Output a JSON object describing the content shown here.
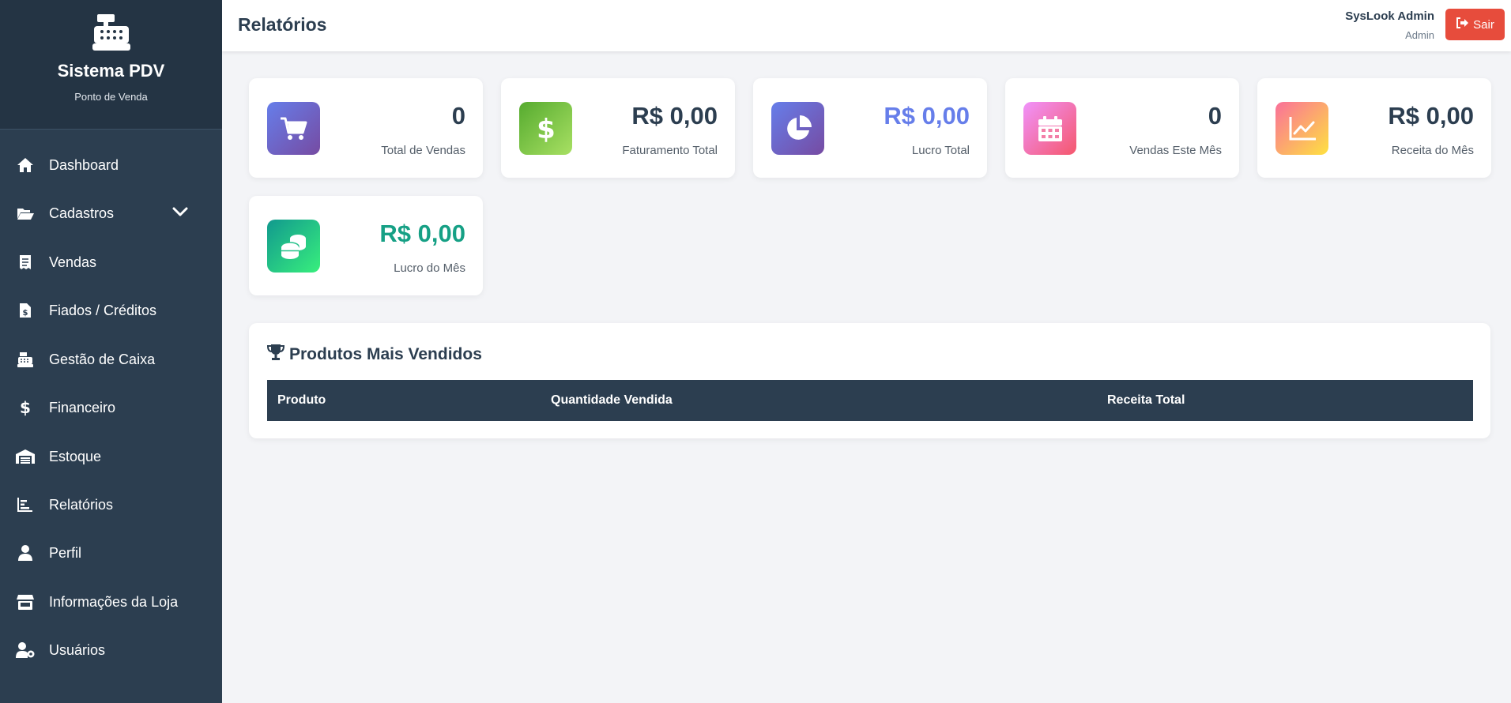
{
  "brand": {
    "title": "Sistema PDV",
    "subtitle": "Ponto de Venda"
  },
  "sidebar": {
    "items": [
      {
        "label": "Dashboard",
        "icon": "home-icon"
      },
      {
        "label": "Cadastros",
        "icon": "folder-open-icon"
      },
      {
        "label": "Vendas",
        "icon": "receipt-icon"
      },
      {
        "label": "Fiados / Créditos",
        "icon": "invoice-dollar-icon"
      },
      {
        "label": "Gestão de Caixa",
        "icon": "cash-register-icon"
      },
      {
        "label": "Financeiro",
        "icon": "dollar-icon"
      },
      {
        "label": "Estoque",
        "icon": "warehouse-icon"
      },
      {
        "label": "Relatórios",
        "icon": "chart-bar-icon"
      },
      {
        "label": "Perfil",
        "icon": "user-icon"
      },
      {
        "label": "Informações da Loja",
        "icon": "store-icon"
      },
      {
        "label": "Usuários",
        "icon": "user-gear-icon"
      }
    ]
  },
  "header": {
    "title": "Relatórios",
    "user_name": "SysLook Admin",
    "user_role": "Admin",
    "logout_label": "Sair"
  },
  "cards": [
    {
      "value": "0",
      "label": "Total de Vendas",
      "icon": "cart-icon",
      "value_color": "#2c3e50"
    },
    {
      "value": "R$ 0,00",
      "label": "Faturamento Total",
      "icon": "dollar-icon",
      "value_color": "#2c3e50"
    },
    {
      "value": "R$ 0,00",
      "label": "Lucro Total",
      "icon": "pie-chart-icon",
      "value_color": "#667eea"
    },
    {
      "value": "0",
      "label": "Vendas Este Mês",
      "icon": "calendar-icon",
      "value_color": "#2c3e50"
    },
    {
      "value": "R$ 0,00",
      "label": "Receita do Mês",
      "icon": "line-chart-icon",
      "value_color": "#2c3e50"
    },
    {
      "value": "R$ 0,00",
      "label": "Lucro do Mês",
      "icon": "coins-icon",
      "value_color": "#16a085"
    }
  ],
  "top_products": {
    "title": "Produtos Mais Vendidos",
    "columns": [
      "Produto",
      "Quantidade Vendida",
      "Receita Total"
    ]
  },
  "colors": {
    "sidebar": "#2c3e50",
    "accent_red": "#e74c3c",
    "profit_blue": "#667eea",
    "profit_teal": "#16a085"
  }
}
